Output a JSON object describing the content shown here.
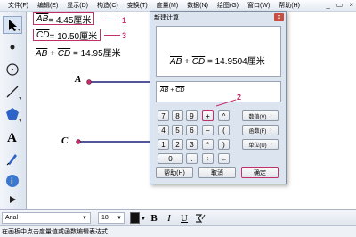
{
  "menu": [
    "文件(F)",
    "编辑(E)",
    "显示(D)",
    "构造(C)",
    "变换(T)",
    "度量(M)",
    "数据(N)",
    "绘图(G)",
    "窗口(W)",
    "帮助(H)"
  ],
  "window_controls": {
    "minimize": "_",
    "restore": "▭",
    "close": "×"
  },
  "canvas": {
    "m1": {
      "name": "AB",
      "value": " = 4.45厘米"
    },
    "m2": {
      "name": "CD",
      "value": " = 10.50厘米"
    },
    "sum": {
      "a": "AB",
      "plus": " + ",
      "b": "CD",
      "value": " = 14.95厘米"
    },
    "point_a": "A",
    "point_c": "C",
    "callout1": "1",
    "callout2": "2",
    "callout3": "3"
  },
  "dialog": {
    "title": "新建计算",
    "close": "x",
    "result": {
      "a": "AB",
      "plus": " + ",
      "b": "CD",
      "value": " = 14.9504厘米"
    },
    "expr": {
      "a": "AB",
      "plus": " + ",
      "b": "CD"
    },
    "keys": [
      [
        "7",
        "8",
        "9",
        "+",
        "^"
      ],
      [
        "4",
        "5",
        "6",
        "−",
        "("
      ],
      [
        "1",
        "2",
        "3",
        "*",
        ")"
      ],
      [
        "0",
        ".",
        "÷",
        "←"
      ]
    ],
    "func_buttons": [
      "数值(V)",
      "函数(F)",
      "单位(U)"
    ],
    "buttons": {
      "help": "帮助(H)",
      "cancel": "取消",
      "ok": "确定"
    }
  },
  "bottom": {
    "font": "Arial",
    "size": "18",
    "bold": "B",
    "italic": "I",
    "underline": "U"
  },
  "status": "在画板中点击度量值或函数编辑表达式"
}
